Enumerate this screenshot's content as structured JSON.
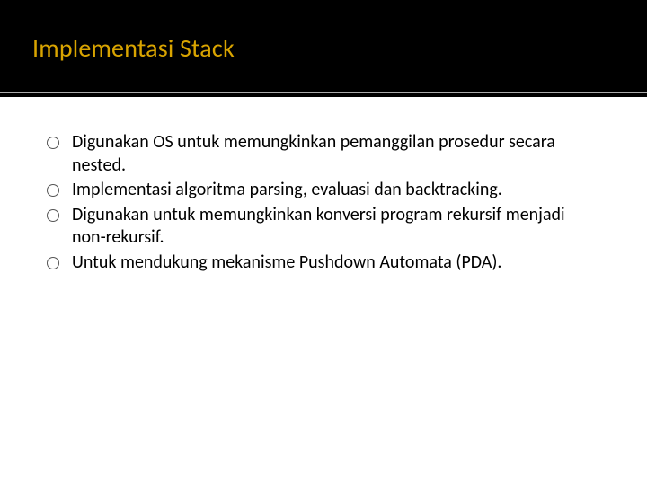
{
  "title": "Implementasi Stack",
  "bullets": [
    "Digunakan OS untuk memungkinkan pemanggilan prosedur secara nested.",
    "Implementasi algoritma parsing, evaluasi dan backtracking.",
    "Digunakan untuk memungkinkan konversi program rekursif menjadi non-rekursif.",
    "Untuk mendukung mekanisme Pushdown Automata (PDA)."
  ]
}
